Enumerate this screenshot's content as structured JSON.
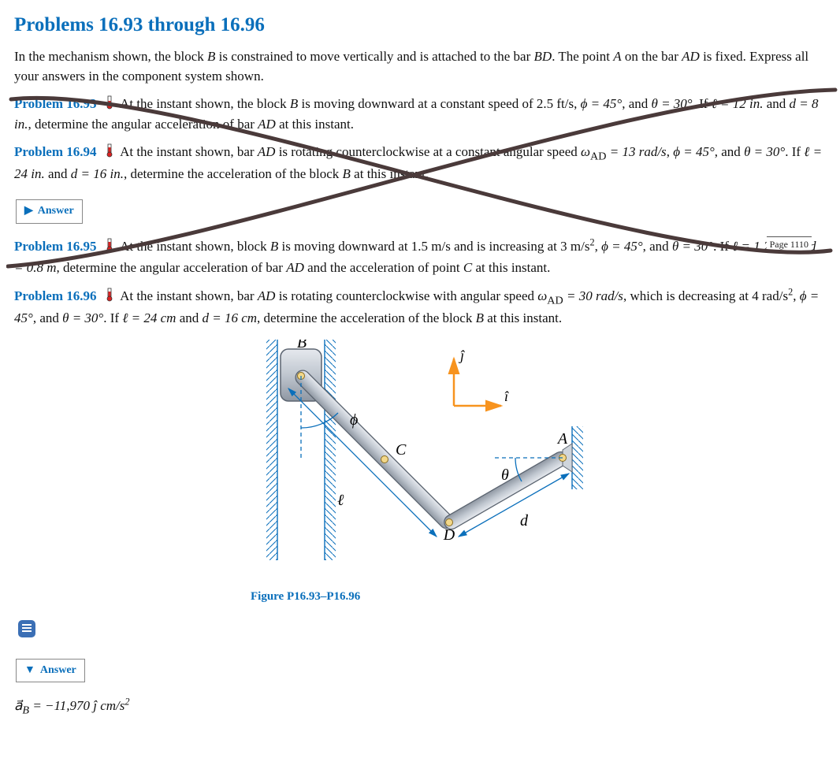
{
  "header": {
    "title": "Problems 16.93 through 16.96"
  },
  "intro": "In the mechanism shown, the block B is constrained to move vertically and is attached to the bar BD. The point A on the bar AD is fixed. Express all your answers in the component system shown.",
  "p93": {
    "label": "Problem 16.93",
    "sent1a": "At the instant shown, the block ",
    "sent1b": " is moving downward at a constant speed of 2.5 ft/s, ",
    "phi": "ϕ = 45°",
    "and1": ", and ",
    "theta": "θ = 30°",
    "sent2a": ". If ",
    "l": "ℓ = 12  in.",
    "and2": " and ",
    "d": "d = 8  in.",
    "tail": ", determine the angular acceleration of bar AD at this instant."
  },
  "p94": {
    "label": "Problem 16.94",
    "sent1": "At the instant shown, bar AD is rotating counterclockwise at a constant angular speed ",
    "omega": "ω_AD = 13 rad/s",
    "c1": ", ",
    "phi": "ϕ = 45°",
    "c2": ", and ",
    "theta": "θ = 30°",
    "sent2a": ". If ",
    "l": "ℓ = 24 in.",
    "and2": " and ",
    "d": "d = 16 in.",
    "tail": ", determine the acceleration of the block B at this instant."
  },
  "answer1": {
    "label": "Answer"
  },
  "p95": {
    "label": "Problem 16.95",
    "sent1": "At the instant shown, block B is moving downward at 1.5 m/s and is increasing at 3 m/s",
    "sq": "2",
    "c1": ", ",
    "phi": "ϕ = 45°",
    "c2": ", and ",
    "theta": "θ = 30°",
    "sent2a": ". If ",
    "l": "ℓ = 1.2 m",
    "and2": " and ",
    "d": "d = 0.8 m",
    "tail": ", determine the angular acceleration of bar AD and the acceleration of point C at this instant."
  },
  "page_badge": "Page 1110",
  "p96": {
    "label": "Problem 16.96",
    "sent1": "At the instant shown, bar AD is rotating counterclockwise with angular speed ",
    "omega": "ω_AD = 30 rad/s",
    "body2": ", which is decreasing at 4 rad/s",
    "sq": "2",
    "c1": ", ",
    "phi": "ϕ = 45°",
    "c2": ", and ",
    "theta": "θ = 30°",
    "sent2a": ". If ",
    "l": "ℓ = 24 cm",
    "and2": " and ",
    "d": "d = 16 cm",
    "tail": ", determine the acceleration of the block B at this instant."
  },
  "figure": {
    "caption": "Figure P16.93–P16.96",
    "B": "B",
    "C": "C",
    "A": "A",
    "D": "D",
    "phi": "ϕ",
    "theta": "θ",
    "ell": "ℓ",
    "d": "d",
    "jhat": "ĵ",
    "ihat": "î"
  },
  "answer2": {
    "label": "Answer"
  },
  "answer2_value_a": "a⃗",
  "answer2_value_sub": "B",
  "answer2_value_b": " = −11,970 ĵ cm/s",
  "answer2_value_sq": "2"
}
